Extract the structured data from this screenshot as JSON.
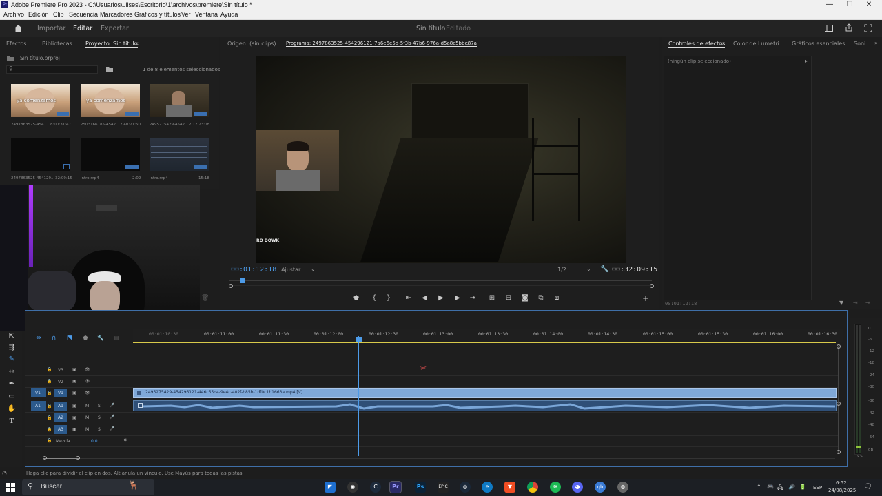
{
  "window": {
    "title": "Adobe Premiere Pro 2023 - C:\\Usuarios\\ulises\\Escritorio\\1\\archivos\\premiere\\Sin título *",
    "app_icon": "Pr",
    "controls": [
      "—",
      "❐",
      "✕"
    ]
  },
  "menubar": [
    "Archivo",
    "Edición",
    "Clip",
    "Secuencia",
    "Marcadores",
    "Gráficos y títulos",
    "Ver",
    "Ventana",
    "Ayuda"
  ],
  "header": {
    "tabs": [
      "Importar",
      "Editar",
      "Exportar"
    ],
    "active_tab": "Editar",
    "project_title": "Sin título",
    "project_status": "Editado"
  },
  "project_panel": {
    "tabs": [
      "Efectos",
      "Bibliotecas",
      "Proyecto: Sin título"
    ],
    "file": "Sin título.prproj",
    "search_placeholder": "",
    "selection_info": "1 de 8 elementos seleccionados",
    "items": [
      {
        "name": "2497863525-454...",
        "duration": "8:00:31:47",
        "caption": "ya comenzamos"
      },
      {
        "name": "2503166185-4542...",
        "duration": "2:40:21:50",
        "caption": "ya comenzamos"
      },
      {
        "name": "2495275429-4542...",
        "duration": "2:12:23:08",
        "caption": ""
      },
      {
        "name": "2497863525-454129...",
        "duration": "32:09:15",
        "caption": ""
      },
      {
        "name": "intro.mp4",
        "duration": "2:02",
        "caption": ""
      },
      {
        "name": "intro.mp4",
        "duration": "15:18",
        "caption": ""
      }
    ]
  },
  "program_monitor": {
    "source_tab": "Origen: (sin clips)",
    "program_tab": "Programa: 2497863525-454296121-7a6e6e5d-5f3b-47b6-976a-d5a8c5bbe87a",
    "overlay_text": "RO DOWK",
    "current_time": "00:01:12:18",
    "fit": "Ajustar",
    "resolution": "1/2",
    "duration": "00:32:09:15"
  },
  "effects_panel": {
    "tabs": [
      "Controles de efectos",
      "Color de Lumetri",
      "Gráficos esenciales",
      "Soni"
    ],
    "no_clip": "(ningún clip seleccionado)",
    "time": "00:01:12:18"
  },
  "timeline": {
    "ruler": [
      "00:01:10:30",
      "00:01:11:00",
      "00:01:11:30",
      "00:01:12:00",
      "00:01:12:30",
      "00:01:13:00",
      "00:01:13:30",
      "00:01:14:00",
      "00:01:14:30",
      "00:01:15:00",
      "00:01:15:30",
      "00:01:16:00",
      "00:01:16:30"
    ],
    "video_tracks": [
      "V3",
      "V2",
      "V1"
    ],
    "audio_tracks": [
      "A1",
      "A2",
      "A3"
    ],
    "source_v": "V1",
    "source_a": "A1",
    "mix_label": "Mezcla",
    "mix_value": "0,0",
    "mute": "M",
    "solo": "S",
    "clip_name": "2495275429-454296121-446c55d4-9e4c-402f-b85b-1df0c1b1663a.mp4 [V]"
  },
  "audio_meter": {
    "labels": [
      "0",
      "-6",
      "-12",
      "-18",
      "-24",
      "-30",
      "-36",
      "-42",
      "-48",
      "-54",
      "dB"
    ],
    "footer": "S S"
  },
  "statusbar": {
    "hint": "Haga clic para dividir el clip en dos. Alt anula un vínculo. Use Mayús para todas las pistas."
  },
  "taskbar": {
    "search_placeholder": "Buscar",
    "lang": "ESP",
    "time": "6:52",
    "date": "24/08/2025",
    "apps": [
      "edge-blue",
      "chrome-dark",
      "cortana",
      "premiere",
      "photoshop",
      "epic",
      "steam",
      "edge",
      "brave",
      "chrome",
      "spotify",
      "discord",
      "qb",
      "misc"
    ]
  },
  "colors": {
    "accent": "#4d9be8",
    "clip": "#7fa8d8",
    "audio_clip": "#2f4f77",
    "panel": "#1e1e1e"
  }
}
